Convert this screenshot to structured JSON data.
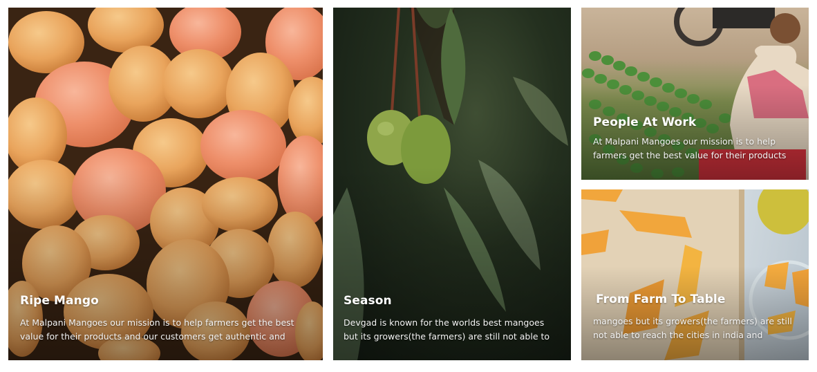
{
  "cards": [
    {
      "title": "Ripe Mango",
      "description": "At Malpani Mangoes our mission is to help farmers get the best value for their products and our customers get authentic and"
    },
    {
      "title": "Season",
      "description": "Devgad is known for the worlds best mangoes but its growers(the farmers) are still not able to"
    },
    {
      "title": "People At Work",
      "description": "At Malpani Mangoes our mission is to help farmers get the best value for their products"
    },
    {
      "title": "From Farm To Table",
      "description": "mangoes but its growers(the farmers) are still not able to reach the cities in india and"
    }
  ],
  "colors": {
    "text": "#ffffff",
    "mango_orange": "#e8894a",
    "mango_yellow": "#f0b85c",
    "leaf_green": "#6f8f3a"
  }
}
